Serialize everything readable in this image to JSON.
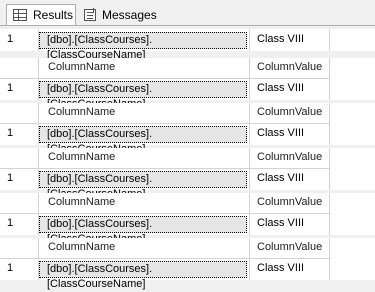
{
  "tabs": [
    {
      "label": "Results",
      "icon": "grid-icon"
    },
    {
      "label": "Messages",
      "icon": "messages-icon"
    }
  ],
  "grid": {
    "headers": {
      "name": "ColumnName",
      "value": "ColumnValue"
    },
    "panels": [
      {
        "row_num": "1",
        "name": "[dbo].[ClassCourses].[ClassCourseName]",
        "value": "Class VIII",
        "has_header": false
      },
      {
        "row_num": "1",
        "name": "[dbo].[ClassCourses].[ClassCourseName]",
        "value": "Class VIII",
        "has_header": true
      },
      {
        "row_num": "1",
        "name": "[dbo].[ClassCourses].[ClassCourseName]",
        "value": "Class VIII",
        "has_header": true
      },
      {
        "row_num": "1",
        "name": "[dbo].[ClassCourses].[ClassCourseName]",
        "value": "Class VIII",
        "has_header": true
      },
      {
        "row_num": "1",
        "name": "[dbo].[ClassCourses].[ClassCourseName]",
        "value": "Class VIII",
        "has_header": true
      },
      {
        "row_num": "1",
        "name": "[dbo].[ClassCourses].[ClassCourseName]",
        "value": "Class VIII",
        "has_header": true
      }
    ]
  }
}
